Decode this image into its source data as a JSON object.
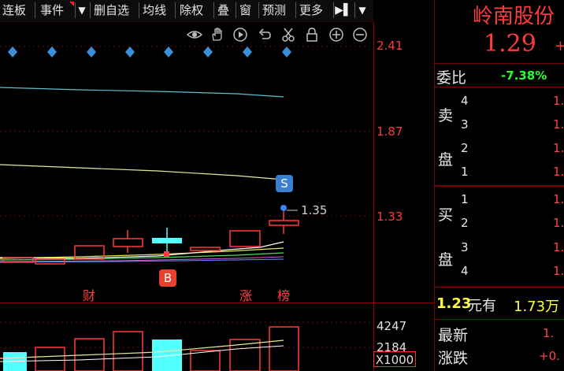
{
  "toolbar": {
    "items": [
      "连板",
      "事件",
      "删自选",
      "均线",
      "除权",
      "叠",
      "窗",
      "预测",
      "更多"
    ],
    "dropdown_glyph": "▼",
    "nav_glyph": "▶▌"
  },
  "tools": [
    "eye-icon",
    "hand-icon",
    "play-icon",
    "undo-icon",
    "scissors-icon",
    "lock-icon",
    "zoom-in-icon",
    "zoom-out-icon"
  ],
  "price_axis": {
    "ticks": [
      "2.41",
      "1.87",
      "1.33"
    ],
    "color": "#ff3b3b"
  },
  "volume_axis": {
    "ticks": [
      "4247",
      "2184"
    ],
    "unit": "X1000"
  },
  "markers": {
    "sell": "S",
    "buy": "B",
    "last_price_label": "1.35",
    "events": [
      "财",
      "涨",
      "榜"
    ]
  },
  "quote": {
    "name": "岭南股份",
    "price": "1.29",
    "price_suffix": "+",
    "weibi_label": "委比",
    "weibi_value": "-7.38%",
    "sell_label": [
      "卖",
      "盘"
    ],
    "buy_label": [
      "买",
      "盘"
    ],
    "sell_levels": [
      "4",
      "3",
      "2",
      "1"
    ],
    "buy_levels": [
      "1",
      "2",
      "3",
      "4"
    ],
    "sell_prices": [
      "1.",
      "1.",
      "1.",
      "1."
    ],
    "buy_prices": [
      "1.",
      "1.",
      "1.",
      "1."
    ],
    "cash_value": "1.23",
    "cash_text": "元有",
    "cash_amount": "1.73万",
    "latest_label": "最新",
    "latest_value": "1.",
    "change_label": "涨跌",
    "change_value": "+0."
  },
  "colors": {
    "up": "#ff3b3b",
    "down": "#54ffff",
    "panel_border": "#7a0000",
    "weibi": "#2cff2c",
    "cash": "#ffff40"
  }
}
